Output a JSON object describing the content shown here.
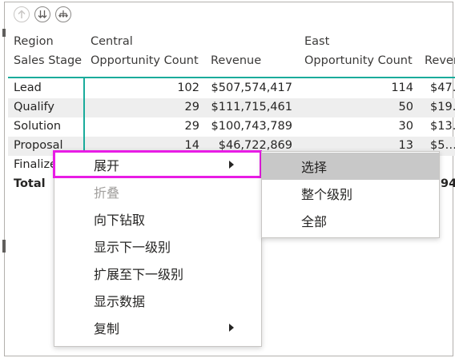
{
  "toolbar": {
    "icons": [
      "drill-up-icon",
      "drill-down-next-level-icon",
      "expand-next-level-icon"
    ]
  },
  "matrix": {
    "row_header_labels": [
      "Region",
      "Sales Stage"
    ],
    "column_groups": [
      "Central",
      "East"
    ],
    "column_headers": [
      "Opportunity Count",
      "Revenue",
      "Opportunity Count",
      "Revenue"
    ],
    "rows": [
      {
        "stage": "Lead",
        "central_count": "102",
        "central_revenue": "$507,574,417",
        "east_count": "114",
        "east_revenue": "$47…"
      },
      {
        "stage": "Qualify",
        "central_count": "29",
        "central_revenue": "$111,715,461",
        "east_count": "50",
        "east_revenue": "$19…"
      },
      {
        "stage": "Solution",
        "central_count": "29",
        "central_revenue": "$100,743,789",
        "east_count": "30",
        "east_revenue": "$13…"
      },
      {
        "stage": "Proposal",
        "central_count": "14",
        "central_revenue": "$46,722,869",
        "east_count": "13",
        "east_revenue": "$5…"
      },
      {
        "stage": "Finalize",
        "central_count": "",
        "central_revenue": "",
        "east_count": "",
        "east_revenue": ""
      }
    ],
    "total": {
      "label": "Total",
      "east_revenue": "94"
    }
  },
  "context_menu": {
    "items": [
      {
        "label": "展开",
        "has_submenu": true,
        "disabled": false
      },
      {
        "label": "折叠",
        "has_submenu": false,
        "disabled": true
      },
      {
        "label": "向下钻取",
        "has_submenu": false,
        "disabled": false
      },
      {
        "label": "显示下一级别",
        "has_submenu": false,
        "disabled": false
      },
      {
        "label": "扩展至下一级别",
        "has_submenu": false,
        "disabled": false
      },
      {
        "label": "显示数据",
        "has_submenu": false,
        "disabled": false
      },
      {
        "label": "复制",
        "has_submenu": true,
        "disabled": false
      }
    ]
  },
  "submenu": {
    "items": [
      {
        "label": "选择",
        "active": true
      },
      {
        "label": "整个级别",
        "active": false
      },
      {
        "label": "全部",
        "active": false
      }
    ]
  },
  "colors": {
    "accent_teal": "#1aab9b",
    "highlight_magenta": "#e81ce5",
    "submenu_active": "#c8c8c8",
    "row_alt": "#eeeeee"
  }
}
